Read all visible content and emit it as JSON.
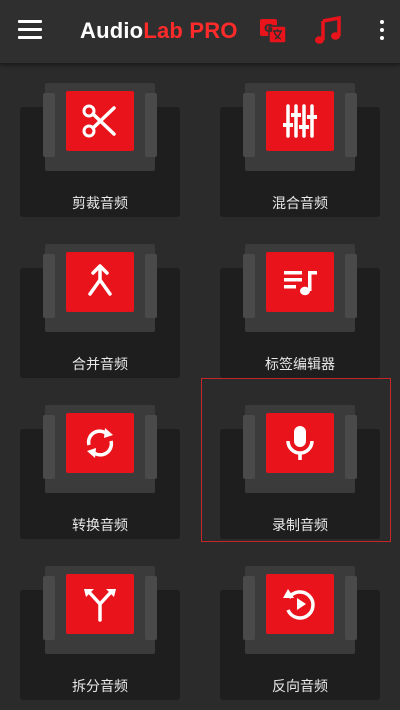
{
  "appbar": {
    "title_part1": "Audio",
    "title_part2": "Lab",
    "title_part3": " PRO",
    "icons": [
      "menu-icon",
      "translate-icon",
      "music-note-icon",
      "more-vertical-icon"
    ]
  },
  "colors": {
    "accent": "#e9141b",
    "background": "#2b2b2b",
    "tile_base": "#1e1e1e"
  },
  "tiles": [
    {
      "label": "剪裁音频",
      "icon": "scissors-icon"
    },
    {
      "label": "混合音频",
      "icon": "mixer-sliders-icon"
    },
    {
      "label": "合并音频",
      "icon": "merge-icon"
    },
    {
      "label": "标签编辑器",
      "icon": "playlist-music-icon"
    },
    {
      "label": "转换音频",
      "icon": "convert-sync-icon"
    },
    {
      "label": "录制音频",
      "icon": "microphone-icon",
      "selected": true
    },
    {
      "label": "拆分音频",
      "icon": "split-icon"
    },
    {
      "label": "反向音频",
      "icon": "reverse-icon"
    }
  ]
}
